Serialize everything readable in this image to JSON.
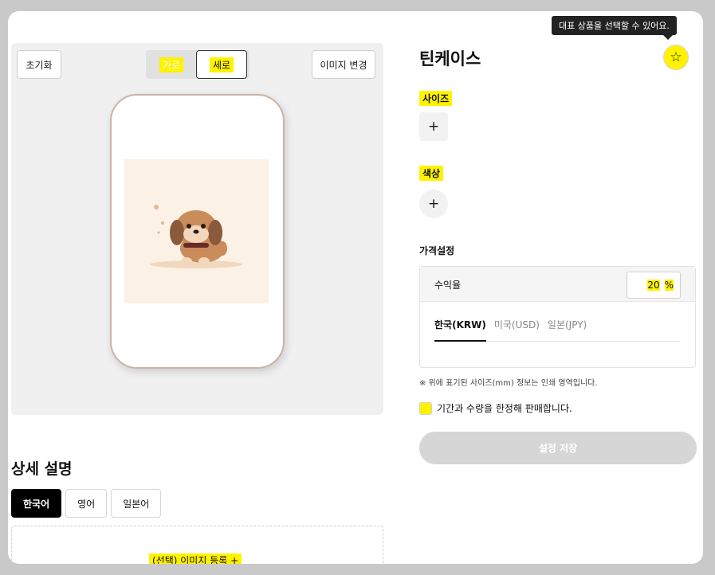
{
  "toolbar": {
    "reset_label": "초기화",
    "orientation_horizontal": "가로",
    "orientation_vertical": "세로",
    "change_image_label": "이미지 변경"
  },
  "detail": {
    "title": "상세 설명",
    "lang_tabs": [
      "한국어",
      "영어",
      "일본어"
    ],
    "upload_label": "(선택) 이미지 등록 +"
  },
  "product": {
    "title": "틴케이스",
    "tooltip": "대표 상품을 선택할 수 있어요.",
    "size_label": "사이즈",
    "color_label": "색상",
    "add_icon": "+"
  },
  "pricing": {
    "section_label": "가격설정",
    "margin_label": "수익율",
    "margin_value": "20",
    "margin_unit": "%",
    "currency_tabs": [
      "한국(KRW)",
      "미국(USD)",
      "일본(JPY)"
    ]
  },
  "note": "※ 위에 표기된 사이즈(mm) 정보는 인쇄 영역입니다.",
  "limit_label": "기간과 수량을 한정해 판매합니다.",
  "save_label": "설정 저장",
  "colors": {
    "highlight": "#fff200",
    "save_disabled": "#d6d6d6"
  }
}
